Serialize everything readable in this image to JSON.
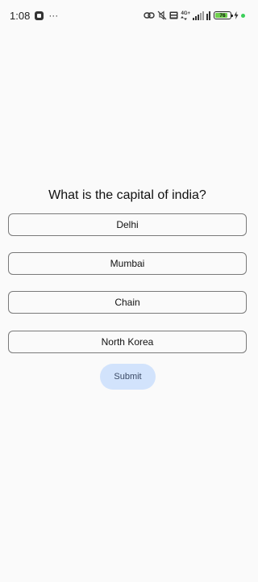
{
  "status_bar": {
    "time": "1:08",
    "more": "···",
    "network_type": "4G+",
    "battery_percent": "76",
    "colors": {
      "battery_fill": "#6fd04d",
      "dot": "#3ccf5a"
    },
    "icons": [
      "app-badge-icon",
      "link-icon",
      "mute-icon",
      "volte-icon",
      "signal-icon",
      "battery-icon",
      "charging-icon"
    ]
  },
  "quiz": {
    "question": "What is the capital of india?",
    "options": [
      "Delhi",
      "Mumbai",
      "Chain",
      "North Korea"
    ],
    "submit_label": "Submit"
  },
  "colors": {
    "background": "#fafafa",
    "option_border": "#7a7a7a",
    "submit_bg": "#d2e3fc",
    "submit_text": "#3b4a66"
  }
}
